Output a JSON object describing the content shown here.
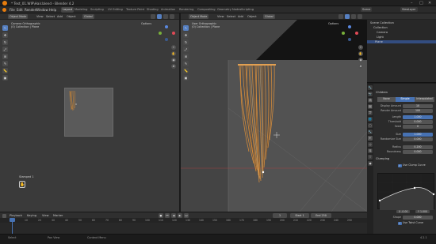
{
  "window": {
    "title": "* Test_01.WIP\\Hair.blend - Blender 4.2",
    "min": "–",
    "max": "□",
    "close": "✕"
  },
  "menu": {
    "items": [
      "File",
      "Edit",
      "Render",
      "Window",
      "Help"
    ],
    "workspaces": [
      "Layout",
      "Modeling",
      "Sculpting",
      "UV Editing",
      "Texture Paint",
      "Shading",
      "Animation",
      "Rendering",
      "Compositing",
      "Geometry Nodes",
      "Scripting"
    ],
    "active_workspace": "Layout",
    "scene": "Scene",
    "view_layer": "ViewLayer"
  },
  "viewport_left": {
    "mode": "Object Mode",
    "menus": [
      "View",
      "Select",
      "Add",
      "Object"
    ],
    "transform": "Global",
    "info": [
      "Camera Orthographic",
      "(0) Collection | Plane"
    ],
    "options": "Options",
    "pose_label": "Stamped 1"
  },
  "viewport_right": {
    "mode": "Object Mode",
    "menus": [
      "View",
      "Select",
      "Add",
      "Object"
    ],
    "transform": "Global",
    "info": [
      "User Orthographic",
      "(0) Collection | Plane"
    ],
    "options": "Options"
  },
  "outliner": {
    "header": "Scene Collection",
    "rows": [
      "Collection",
      "Camera",
      "Light",
      "Plane"
    ],
    "selected": "Plane"
  },
  "properties": {
    "section": "Children",
    "modes": [
      "None",
      "Simple",
      "Interpolated"
    ],
    "active_mode": "Simple",
    "rows": [
      {
        "label": "Display Amount",
        "value": "10",
        "blue": false
      },
      {
        "label": "Render Amount",
        "value": "100",
        "blue": false
      },
      {
        "label": "Length",
        "value": "1.000",
        "blue": true
      },
      {
        "label": "Threshold",
        "value": "0.000",
        "blue": false
      },
      {
        "label": "Seed",
        "value": "0",
        "blue": false
      },
      {
        "label": "Size",
        "value": "1.000",
        "blue": true
      },
      {
        "label": "Randomize Size",
        "value": "0.000",
        "blue": false
      },
      {
        "label": "Radius",
        "value": "0.200",
        "blue": false
      },
      {
        "label": "Roundness",
        "value": "0.000",
        "blue": false
      }
    ],
    "clumping": "Clumping",
    "use_clump_curve": "Use Clump Curve",
    "curve_footer": [
      "X -0.00",
      "Y 1.000"
    ],
    "shape_label": "Shape",
    "shape_value": "0.000",
    "use_twist": "Use Twist Curve"
  },
  "timeline": {
    "menus": [
      "Playback",
      "Keying",
      "View",
      "Marker"
    ],
    "current_frame": "1",
    "start_label": "Start",
    "start": "1",
    "end_label": "End",
    "end": "250",
    "ticks": [
      "0",
      "10",
      "20",
      "30",
      "40",
      "50",
      "60",
      "70",
      "80",
      "90",
      "100",
      "110",
      "120",
      "130",
      "140",
      "150",
      "160",
      "170",
      "180",
      "190",
      "200",
      "210",
      "220",
      "230",
      "240",
      "250"
    ]
  },
  "status": {
    "left": "Select",
    "middle": "Pan View",
    "right": "Context Menu",
    "version": "4.2.1"
  },
  "colors": {
    "accent": "#4772b3",
    "hair": "#d08a3c",
    "background": "#3d3d3d"
  },
  "icons": [
    "blender-logo-icon",
    "cursor-icon",
    "move-icon",
    "rotate-icon",
    "scale-icon",
    "transform-icon",
    "annotate-icon",
    "measure-icon",
    "add-cube-icon",
    "hand-icon",
    "zoom-icon",
    "camera-icon"
  ]
}
